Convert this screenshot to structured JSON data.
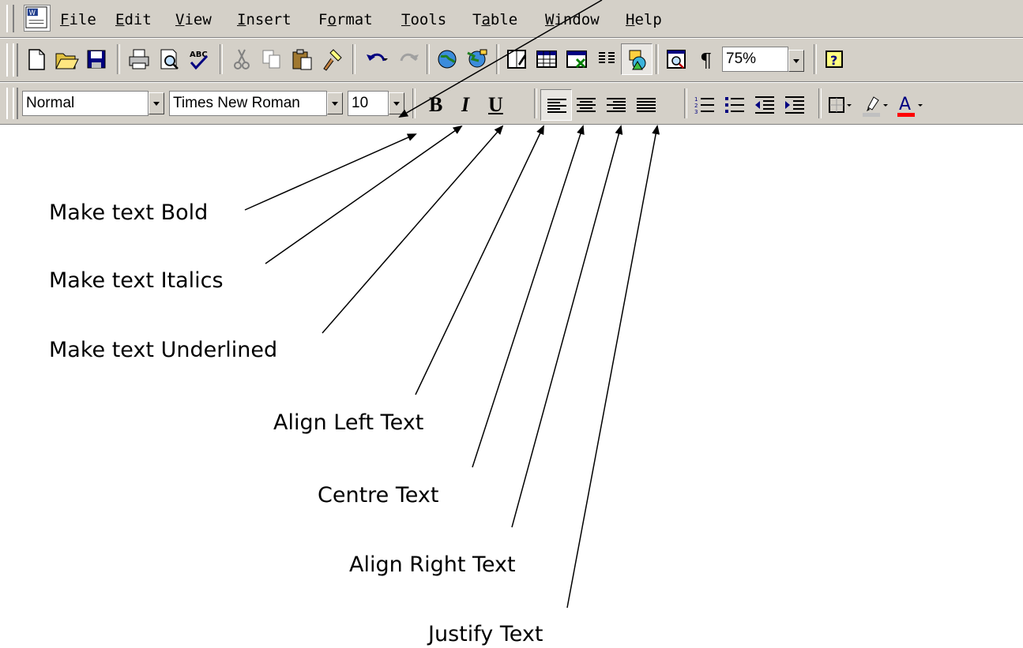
{
  "menu": {
    "items": [
      {
        "first": "F",
        "rest": "ile"
      },
      {
        "first": "E",
        "rest": "dit"
      },
      {
        "first": "V",
        "rest": "iew"
      },
      {
        "first": "I",
        "rest": "nsert"
      },
      {
        "first": "F",
        "rest": "ormat"
      },
      {
        "first": "T",
        "rest": "ools"
      },
      {
        "first": "Ta",
        "rest": "ble"
      },
      {
        "first": "W",
        "rest": "indow"
      },
      {
        "first": "H",
        "rest": "elp"
      }
    ]
  },
  "standard_toolbar": {
    "zoom": "75%",
    "icons": [
      "new-icon",
      "open-icon",
      "save-icon",
      "print-icon",
      "print-preview-icon",
      "spelling-icon",
      "cut-icon",
      "copy-icon",
      "paste-icon",
      "format-painter-icon",
      "undo-icon",
      "redo-icon",
      "hyperlink-icon",
      "web-toolbar-icon",
      "tables-borders-icon",
      "insert-table-icon",
      "insert-excel-icon",
      "columns-icon",
      "drawing-icon",
      "document-map-icon",
      "show-hide-icon",
      "help-icon"
    ]
  },
  "formatting_toolbar": {
    "style": "Normal",
    "font": "Times New Roman",
    "size": "10",
    "bold": "B",
    "italic": "I",
    "underline": "U"
  },
  "annotations": {
    "bold": "Make text Bold",
    "italics": "Make text Italics",
    "underlined": "Make text Underlined",
    "align_left": "Align Left Text",
    "centre": "Centre Text",
    "align_right": "Align Right Text",
    "justify": "Justify Text"
  },
  "colors": {
    "toolbar_bg": "#d4d0c8",
    "highlight": "#ffff00",
    "font_color": "#ff0000"
  }
}
